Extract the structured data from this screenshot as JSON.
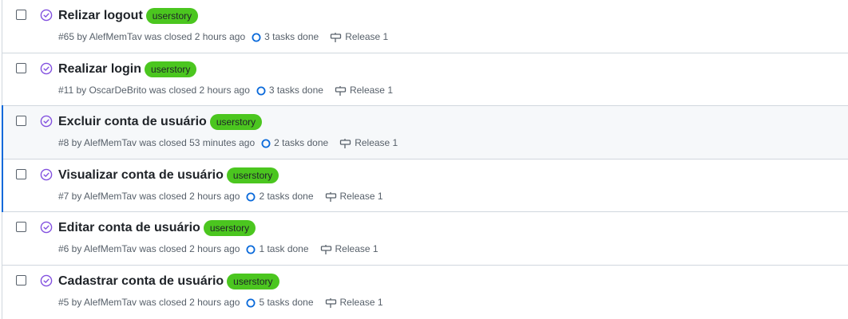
{
  "colors": {
    "label_bg": "#4bc61f",
    "closed_icon": "#8250df",
    "task_icon": "#0969da",
    "highlight_border": "#0969da"
  },
  "issues": [
    {
      "title": "Relizar logout",
      "label": "userstory",
      "meta": "#65 by AlefMemTav was closed 2 hours ago",
      "tasks": "3 tasks done",
      "milestone": "Release 1"
    },
    {
      "title": "Realizar login",
      "label": "userstory",
      "meta": "#11 by OscarDeBrito was closed 2 hours ago",
      "tasks": "3 tasks done",
      "milestone": "Release 1"
    },
    {
      "title": "Excluir conta de usuário",
      "label": "userstory",
      "meta": "#8 by AlefMemTav was closed 53 minutes ago",
      "tasks": "2 tasks done",
      "milestone": "Release 1"
    },
    {
      "title": "Visualizar conta de usuário",
      "label": "userstory",
      "meta": "#7 by AlefMemTav was closed 2 hours ago",
      "tasks": "2 tasks done",
      "milestone": "Release 1"
    },
    {
      "title": "Editar conta de usuário",
      "label": "userstory",
      "meta": "#6 by AlefMemTav was closed 2 hours ago",
      "tasks": "1 task done",
      "milestone": "Release 1"
    },
    {
      "title": "Cadastrar conta de usuário",
      "label": "userstory",
      "meta": "#5 by AlefMemTav was closed 2 hours ago",
      "tasks": "5 tasks done",
      "milestone": "Release 1"
    }
  ]
}
